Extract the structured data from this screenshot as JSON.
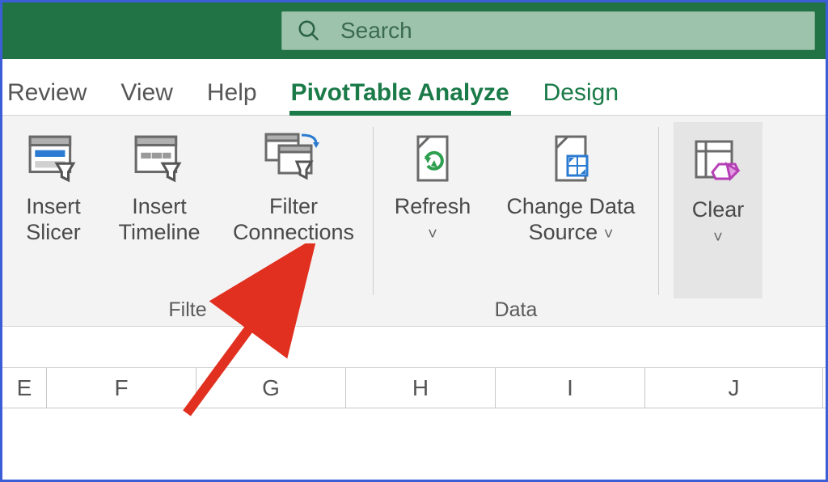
{
  "search": {
    "placeholder": "Search"
  },
  "tabs": {
    "review": "Review",
    "view": "View",
    "help": "Help",
    "pivot": "PivotTable Analyze",
    "design": "Design"
  },
  "ribbon": {
    "filter": {
      "label": "Filte",
      "slicer": "Insert\nSlicer",
      "timeline": "Insert\nTimeline",
      "connections": "Filter\nConnections"
    },
    "data": {
      "label": "Data",
      "refresh": "Refresh",
      "change": "Change Data\nSource"
    },
    "actions": {
      "clear": "Clear"
    }
  },
  "columns": [
    "E",
    "F",
    "G",
    "H",
    "I",
    "J"
  ],
  "dropdown_glyph": "˅"
}
